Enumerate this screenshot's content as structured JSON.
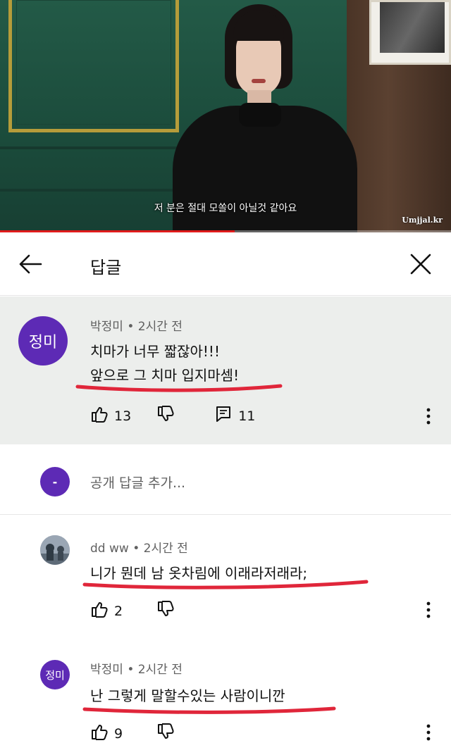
{
  "video": {
    "subtitle": "저 분은 절대 모쏠이 아닐것 같아요",
    "watermark": "Umjjal.kr",
    "progress": 0.52
  },
  "header": {
    "title": "답글"
  },
  "main_comment": {
    "avatar_text": "정미",
    "author": "박정미",
    "time": "2시간 전",
    "line1": "치마가 너무 짧잖아!!!",
    "line2": "앞으로 그 치마 입지마셈!",
    "likes": "13",
    "replies": "11"
  },
  "add_reply": {
    "placeholder": "공개 답글 추가..."
  },
  "replies": [
    {
      "author": "dd ww",
      "time": "2시간 전",
      "text": "니가 뭔데 남 옷차림에 이래라저래라;",
      "likes": "2"
    },
    {
      "avatar_text": "정미",
      "author": "박정미",
      "time": "2시간 전",
      "text": "난 그렇게 말할수있는 사람이니깐",
      "likes": "9"
    }
  ],
  "colors": {
    "avatar": "#5d2ab5",
    "underline": "#e0263a",
    "progress": "#e01b1b"
  }
}
